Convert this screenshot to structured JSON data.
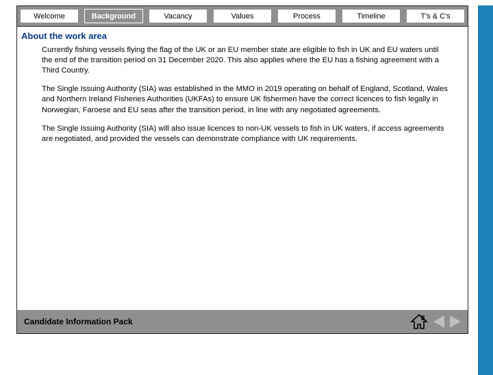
{
  "tabs": {
    "welcome": "Welcome",
    "background": "Background",
    "vacancy": "Vacancy",
    "values": "Values",
    "process": "Process",
    "timeline": "Timeline",
    "terms": "T's & C's"
  },
  "section_title": "About the work area",
  "paragraphs": {
    "p1": "Currently fishing vessels flying the flag of the UK or an EU member state are eligible to fish in UK and EU waters until the end of the transition period on 31 December 2020. This also applies where the EU has a fishing agreement with a Third Country.",
    "p2": "The Single Issuing Authority (SIA) was established in the MMO in 2019 operating on behalf of England, Scotland, Wales and Northern Ireland Fisheries Authorities (UKFAs) to ensure UK fishermen have the correct licences to fish legally in Norwegian, Faroese and EU seas after the transition period, in line with any negotiated agreements.",
    "p3": "The Single Issuing Authority (SIA) will also issue licences to non-UK vessels to fish in UK waters, if access agreements are negotiated, and provided the vessels can demonstrate compliance with UK requirements."
  },
  "footer": {
    "label": "Candidate Information Pack"
  }
}
